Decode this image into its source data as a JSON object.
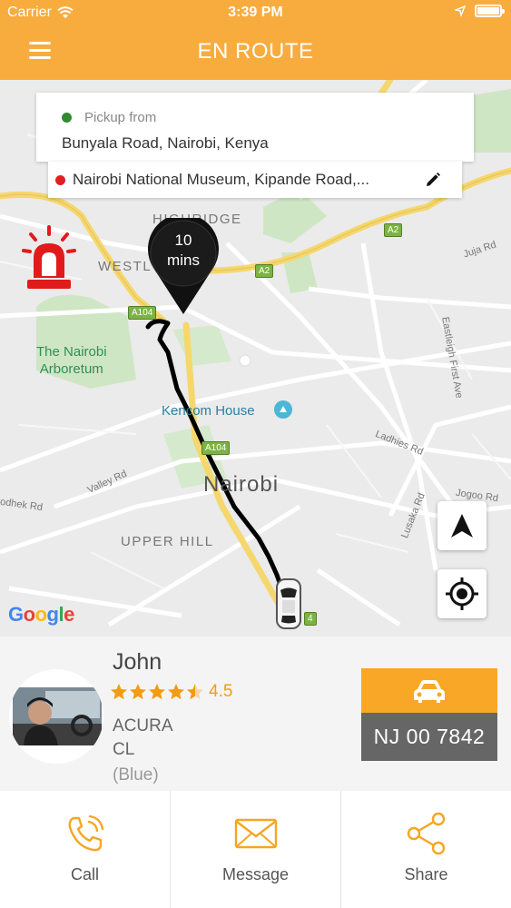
{
  "status_bar": {
    "carrier": "Carrier",
    "time": "3:39 PM"
  },
  "header": {
    "title": "EN ROUTE"
  },
  "trip": {
    "pickup_label": "Pickup from",
    "pickup_address": "Bunyala Road, Nairobi, Kenya",
    "dropoff_address": "Nairobi National Museum, Kipande Road,..."
  },
  "eta": {
    "value": "10",
    "unit": "mins"
  },
  "map": {
    "labels": {
      "highridge": "HIGHRIDGE",
      "westlands": "WESTL",
      "arboretum_1": "The Nairobi",
      "arboretum_2": "Arboretum",
      "kencom": "Kencom House",
      "nairobi": "Nairobi",
      "upper_hill": "UPPER HILL",
      "juja": "Juja Rd",
      "eastleigh": "Eastleigh First Ave",
      "ladhies": "Ladhies Rd",
      "jogoo": "Jogoo Rd",
      "valley": "Valley Rd",
      "lusaka": "Lusaka Rd",
      "ngong": "odhek Rd"
    },
    "badges": {
      "a104_top": "A104",
      "a104_mid": "A104",
      "a2_top": "A2",
      "a2_mid": "A2",
      "a104_bottom": "4"
    },
    "attribution": "Google"
  },
  "driver": {
    "name": "John",
    "rating": "4.5",
    "rating_value": 4.5,
    "rating_max": 5,
    "car_make": "ACURA",
    "car_model": "CL",
    "car_color": "(Blue)",
    "plate": "NJ 00 7842"
  },
  "actions": {
    "call": "Call",
    "message": "Message",
    "share": "Share"
  },
  "colors": {
    "primary": "#f8ac3e",
    "plate_bg": "#666666",
    "pickup_dot": "#2e8b2e",
    "dropoff_dot": "#e02020",
    "siren": "#e11b1b",
    "star": "#f39c12"
  },
  "icons": {
    "menu": "hamburger-icon",
    "edit": "pencil-icon",
    "siren": "siren-icon",
    "navigate": "navigation-arrow-icon",
    "locate": "crosshair-icon",
    "vehicle": "taxi-icon",
    "call": "phone-icon",
    "message": "envelope-icon",
    "share": "share-icon"
  }
}
